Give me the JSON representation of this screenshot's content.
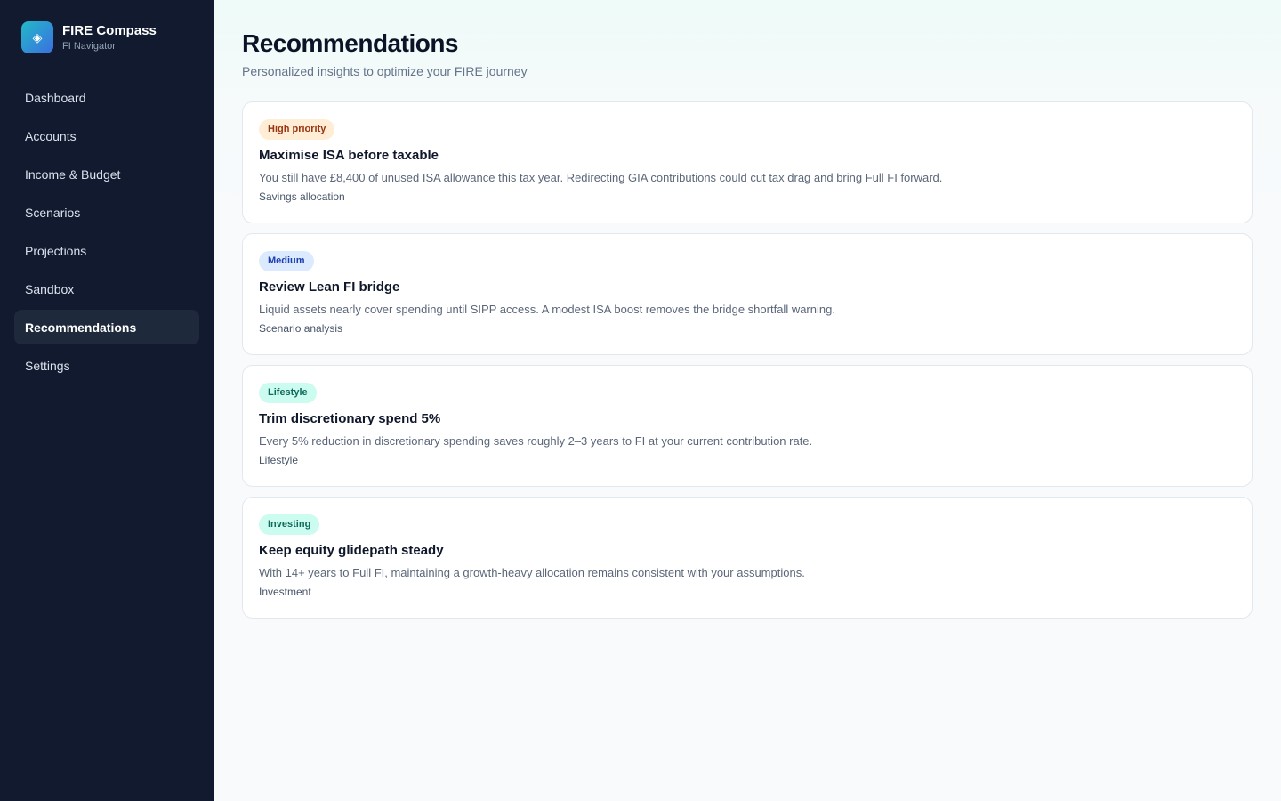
{
  "brand": {
    "name": "FIRE Compass",
    "subtitle": "FI Navigator",
    "logo_icon": "diamond-icon"
  },
  "sidebar": {
    "items": [
      {
        "label": "Dashboard",
        "active": false
      },
      {
        "label": "Accounts",
        "active": false
      },
      {
        "label": "Income & Budget",
        "active": false
      },
      {
        "label": "Scenarios",
        "active": false
      },
      {
        "label": "Projections",
        "active": false
      },
      {
        "label": "Sandbox",
        "active": false
      },
      {
        "label": "Recommendations",
        "active": true
      },
      {
        "label": "Settings",
        "active": false
      }
    ]
  },
  "page": {
    "title": "Recommendations",
    "subtitle": "Personalized insights to optimize your FIRE journey"
  },
  "recommendations": [
    {
      "badge": "High priority",
      "title": "Maximise ISA before taxable",
      "description": "You still have £8,400 of unused ISA allowance this tax year. Redirecting GIA contributions could cut tax drag and bring Full FI forward.",
      "category": "Savings allocation"
    },
    {
      "badge": "Medium",
      "title": "Review Lean FI bridge",
      "description": "Liquid assets nearly cover spending until SIPP access. A modest ISA boost removes the bridge shortfall warning.",
      "category": "Scenario analysis"
    },
    {
      "badge": "Lifestyle",
      "title": "Trim discretionary spend 5%",
      "description": "Every 5% reduction in discretionary spending saves roughly 2–3 years to FI at your current contribution rate.",
      "category": "Lifestyle"
    },
    {
      "badge": "Investing",
      "title": "Keep equity glidepath steady",
      "description": "With 14+ years to Full FI, maintaining a growth-heavy allocation remains consistent with your assumptions.",
      "category": "Investment"
    }
  ],
  "colors": {
    "sidebar_bg": "#111a2e",
    "active_nav_bg": "#1e293b",
    "badge_high_bg": "#ffedd5",
    "badge_high_text": "#9a3412",
    "badge_medium_bg": "#dbeafe",
    "badge_medium_text": "#1e40af",
    "badge_teal_bg": "#ccfbef",
    "badge_teal_text": "#0f6b5b"
  }
}
